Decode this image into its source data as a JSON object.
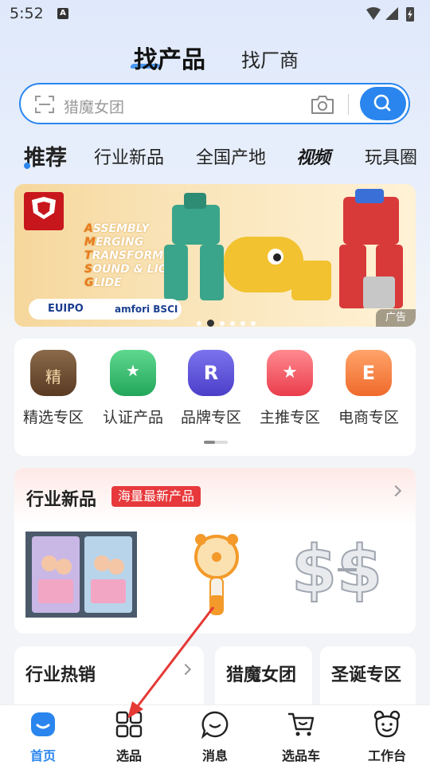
{
  "status_bar": {
    "time": "5:52",
    "notif_glyph": "A"
  },
  "top_tabs": {
    "primary": "找产品",
    "secondary": "找厂商"
  },
  "search": {
    "placeholder": "猎魔女团"
  },
  "categories": [
    {
      "label": "推荐",
      "active": true
    },
    {
      "label": "行业新品"
    },
    {
      "label": "全国产地"
    },
    {
      "label": "视频"
    },
    {
      "label": "玩具圈"
    }
  ],
  "banner": {
    "lines": [
      "ASSEMBLY",
      "MERGING",
      "TRANSFORM",
      "SOUND & LIGHT",
      "GLIDE"
    ],
    "badge_left": "EUIPO",
    "badge_right": "amfori BSCI",
    "ad_label": "广告",
    "page_index": 2,
    "page_count": 6
  },
  "quick_entries": [
    {
      "label": "精选专区",
      "glyph": "精",
      "icon": "shopping-bag-icon",
      "color": "#6b4a2a"
    },
    {
      "label": "认证产品",
      "glyph": "★",
      "icon": "certificate-icon",
      "color": "#2eb86b"
    },
    {
      "label": "品牌专区",
      "glyph": "R",
      "icon": "brand-r-icon",
      "color": "#5a4fd6"
    },
    {
      "label": "主推专区",
      "glyph": "★",
      "icon": "featured-star-icon",
      "color": "#f04b5a"
    },
    {
      "label": "电商专区",
      "glyph": "E",
      "icon": "ecommerce-bag-icon",
      "color": "#f27a3a"
    }
  ],
  "new_products": {
    "title": "行业新品",
    "tag": "海量最新产品"
  },
  "bottom_cards": [
    {
      "title": "行业热销"
    },
    {
      "title": "猎魔女团"
    },
    {
      "title": "圣诞专区"
    }
  ],
  "nav": [
    {
      "label": "首页",
      "icon": "home-icon",
      "active": true
    },
    {
      "label": "选品",
      "icon": "grid-icon"
    },
    {
      "label": "消息",
      "icon": "message-icon"
    },
    {
      "label": "选品车",
      "icon": "cart-icon"
    },
    {
      "label": "工作台",
      "icon": "workbench-icon"
    }
  ],
  "colors": {
    "accent": "#2a86ee",
    "tag_red": "#e7393b",
    "annotation_red": "#e53935"
  }
}
